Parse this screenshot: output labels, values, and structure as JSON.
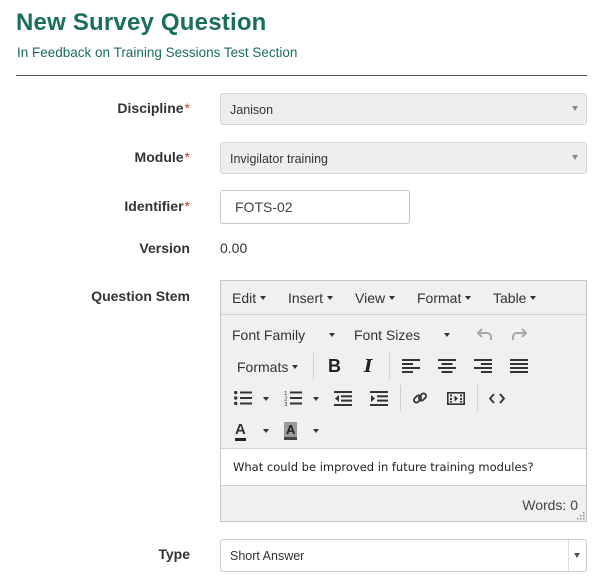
{
  "header": {
    "title": "New Survey Question",
    "subtitle": "In Feedback on Training Sessions Test Section"
  },
  "form": {
    "discipline": {
      "label": "Discipline",
      "required_mark": "*",
      "value": "Janison"
    },
    "module": {
      "label": "Module",
      "required_mark": "*",
      "value": "Invigilator training"
    },
    "identifier": {
      "label": "Identifier",
      "required_mark": "*",
      "value": "FOTS-02"
    },
    "version": {
      "label": "Version",
      "value": "0.00"
    },
    "question_stem": {
      "label": "Question Stem"
    },
    "type": {
      "label": "Type",
      "value": "Short Answer"
    }
  },
  "editor": {
    "menu": [
      "Edit",
      "Insert",
      "View",
      "Format",
      "Table"
    ],
    "font_family_label": "Font Family",
    "font_sizes_label": "Font Sizes",
    "formats_label": "Formats",
    "bold_glyph": "B",
    "italic_glyph": "I",
    "text_color_glyph": "A",
    "bg_color_glyph": "A",
    "content": "What could be improved in future training modules?",
    "word_count": "Words: 0",
    "icons": [
      "undo-icon",
      "redo-icon",
      "bold-icon",
      "italic-icon",
      "align-left-icon",
      "align-center-icon",
      "align-right-icon",
      "align-justify-icon",
      "bullet-list-icon",
      "numbered-list-icon",
      "outdent-icon",
      "indent-icon",
      "link-icon",
      "media-icon",
      "source-code-icon",
      "text-color-icon",
      "background-color-icon"
    ]
  },
  "colors": {
    "title": "#1a6e5c",
    "required": "#c0392b",
    "editor_bg": "#f0f0f0"
  }
}
